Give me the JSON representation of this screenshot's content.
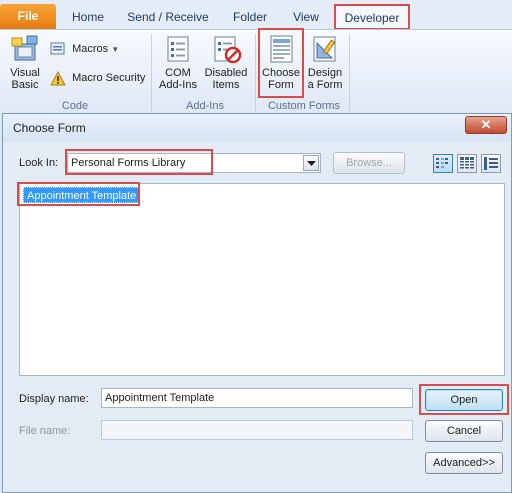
{
  "ribbon_tabs": {
    "file": "File",
    "home": "Home",
    "send_receive": "Send / Receive",
    "folder": "Folder",
    "view": "View",
    "developer": "Developer"
  },
  "ribbon": {
    "code_group": {
      "label": "Code",
      "visual_basic": "Visual\nBasic",
      "macros": "Macros",
      "macro_security": "Macro Security"
    },
    "addins_group": {
      "label": "Add-Ins",
      "com_addins": "COM\nAdd-Ins",
      "disabled_items": "Disabled\nItems"
    },
    "custom_forms_group": {
      "label": "Custom Forms",
      "choose_form": "Choose\nForm",
      "design_form": "Design\na Form"
    }
  },
  "dialog": {
    "title": "Choose Form",
    "close_glyph": "✕",
    "look_in_label": "Look In:",
    "look_in_value": "Personal Forms Library",
    "browse_label": "Browse...",
    "list_items": [
      "Appointment Template"
    ],
    "display_name_label": "Display name:",
    "display_name_value": "Appointment Template",
    "file_name_label": "File name:",
    "file_name_value": "",
    "open_label": "Open",
    "cancel_label": "Cancel",
    "advanced_label": "Advanced>>"
  },
  "colors": {
    "highlight_box": "#d94c4c",
    "selection": "#3399ff",
    "file_tab": "#e67a0f"
  }
}
